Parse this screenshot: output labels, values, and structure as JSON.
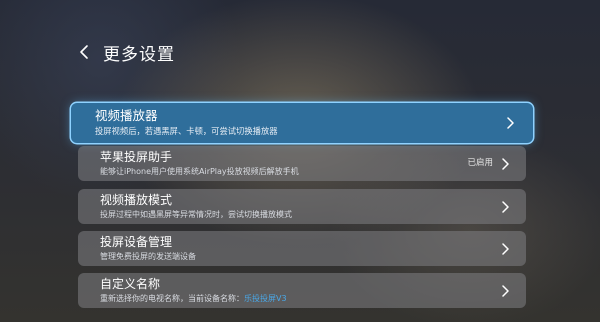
{
  "header": {
    "back_icon": "chevron-left-icon",
    "title": "更多设置"
  },
  "settings": [
    {
      "title": "视频播放器",
      "description": "投屏视频后，若遇黑屏、卡顿，可尝试切换播放器",
      "focused": true,
      "icon": "chevron-right-icon"
    },
    {
      "title": "苹果投屏助手",
      "description": "能够让iPhone用户使用系统AirPlay投放视频后解放手机",
      "status": "已启用",
      "icon": "chevron-right-icon"
    },
    {
      "title": "视频播放模式",
      "description": "投屏过程中如遇黑屏等异常情况时，尝试切换播放模式",
      "icon": "chevron-right-icon"
    },
    {
      "title": "投屏设备管理",
      "description": "管理免费投屏的发送端设备",
      "icon": "chevron-right-icon"
    },
    {
      "title": "自定义名称",
      "description": "重新选择你的电视名称，当前设备名称：",
      "device_name": "乐投投屏V3",
      "icon": "chevron-right-icon"
    }
  ],
  "colors": {
    "focus_background": "#2f6e9b",
    "focus_border": "#8fd2ff",
    "item_background": "#808084",
    "highlight_text": "#4aa8e8"
  }
}
